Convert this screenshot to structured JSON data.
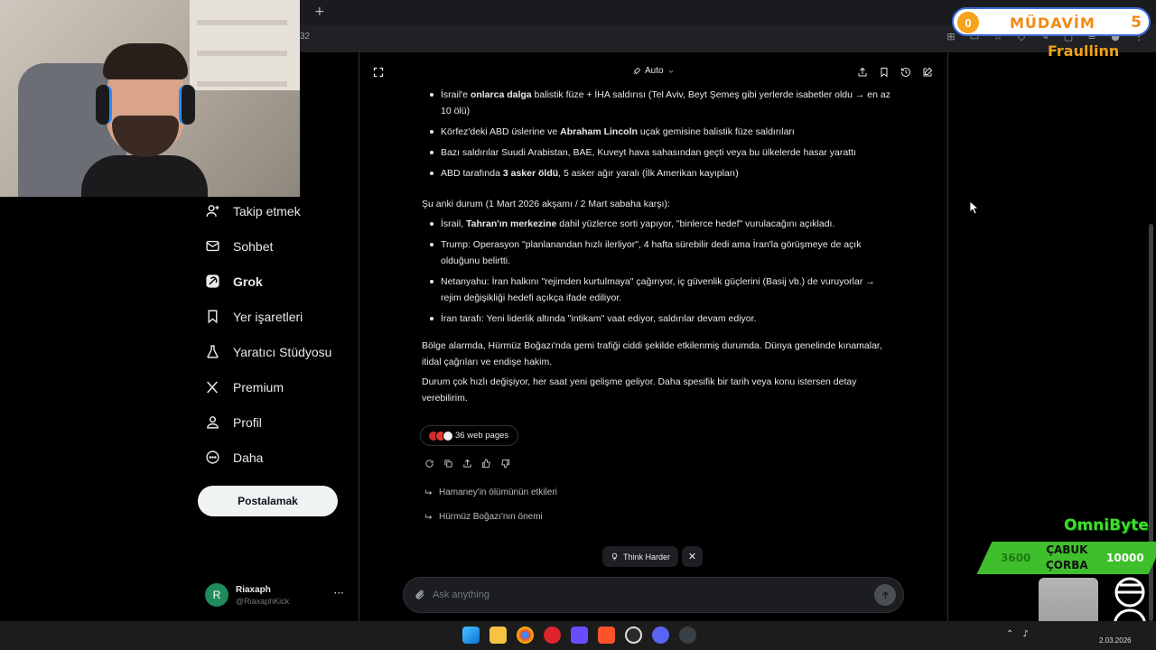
{
  "browser": {
    "new_tab": "+",
    "address_fragment": "32"
  },
  "sidebar": {
    "items": [
      {
        "label": "Takip etmek",
        "icon": "add-person-icon"
      },
      {
        "label": "Sohbet",
        "icon": "mail-icon"
      },
      {
        "label": "Grok",
        "icon": "grok-icon",
        "active": true
      },
      {
        "label": "Yer işaretleri",
        "icon": "bookmark-icon"
      },
      {
        "label": "Yaratıcı Stüdyosu",
        "icon": "flask-icon"
      },
      {
        "label": "Premium",
        "icon": "x-logo-icon"
      },
      {
        "label": "Profil",
        "icon": "person-icon"
      },
      {
        "label": "Daha",
        "icon": "more-circle-icon"
      }
    ],
    "post_button": "Postalamak",
    "account": {
      "initial": "R",
      "name": "Riaxaph",
      "handle": "@RiaxaphKick",
      "more": "···"
    }
  },
  "header": {
    "mode": "Auto"
  },
  "answer": {
    "bullets_a": [
      {
        "pre": "İsrail'e ",
        "bold": "onlarca dalga",
        "post": " balistik füze + İHA saldırısı (Tel Aviv, Beyt Şemeş gibi yerlerde isabetler oldu → en az 10 ölü)"
      },
      {
        "pre": "Körfez'deki ABD üslerine ve ",
        "bold": "Abraham Lincoln",
        "post": " uçak gemisine balistik füze saldırıları"
      },
      {
        "pre": "Bazı saldırılar Suudi Arabistan, BAE, Kuveyt hava sahasından geçti veya bu ülkelerde hasar yarattı",
        "bold": "",
        "post": ""
      },
      {
        "pre": "ABD tarafında ",
        "bold": "3 asker öldü",
        "post": ", 5 asker ağır yaralı (İlk Amerikan kayıpları)"
      }
    ],
    "status_heading": "Şu anki durum (1 Mart 2026 akşamı / 2 Mart sabaha karşı):",
    "bullets_b": [
      {
        "pre": "İsrail, ",
        "bold": "Tahran'ın merkezine",
        "post": " dahil yüzlerce sorti yapıyor, \"binlerce hedef\" vurulacağını açıkladı."
      },
      {
        "pre": "Trump: Operasyon \"planlanandan hızlı ilerliyor\", 4 hafta sürebilir dedi ama İran'la görüşmeye de açık olduğunu belirtti.",
        "bold": "",
        "post": ""
      },
      {
        "pre": "Netanyahu: İran halkını \"rejimden kurtulmaya\" çağırıyor, iç güvenlik güçlerini (Basij vb.) de vuruyorlar → rejim değişikliği hedefi açıkça ifade ediliyor.",
        "bold": "",
        "post": ""
      },
      {
        "pre": "İran tarafı: Yeni liderlik altında \"intikam\" vaat ediyor, saldırılar devam ediyor.",
        "bold": "",
        "post": ""
      }
    ],
    "para1": "Bölge alarmda, Hürmüz Boğazı'nda gemi trafiği ciddi şekilde etkilenmiş durumda. Dünya genelinde kınamalar, itidal çağrıları ve endişe hakim.",
    "para2": "Durum çok hızlı değişiyor, her saat yeni gelişme geliyor. Daha spesifik bir tarih veya konu istersen detay verebilirim."
  },
  "sources": {
    "label": "36 web pages"
  },
  "suggestions": [
    "Hamaney'in ölümünün etkileri",
    "Hürmüz Boğazı'nın önemi"
  ],
  "think": {
    "label": "Think Harder",
    "close": "✕"
  },
  "ask": {
    "placeholder": "Ask anything"
  },
  "overlay": {
    "badge_count": "0",
    "rank": "MÜDAVİM",
    "level": "5",
    "username": "Fraullinn",
    "brand": "OmniByte",
    "soup_left": "3600",
    "soup_mid_1": "ÇABUK",
    "soup_mid_2": "ÇORBA",
    "soup_right": "10000"
  },
  "taskbar": {
    "date": "2.03.2026"
  },
  "colors": {
    "accent": "#1d9bf0",
    "background": "#000000",
    "text": "#e7e9ea",
    "badge_orange": "#f08a14",
    "omni_green": "#3fdc2c"
  }
}
